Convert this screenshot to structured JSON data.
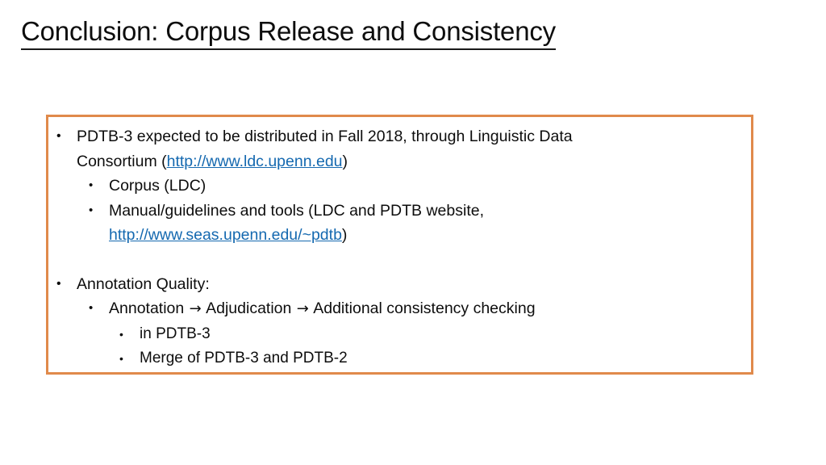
{
  "slide": {
    "title": "Conclusion: Corpus Release and Consistency",
    "bullet_marker": "•",
    "accent_color": "#e08a4b",
    "link_color": "#1569b0",
    "text_color": "#0d0d0d",
    "background_color": "#ffffff"
  },
  "content": {
    "b1_part1": "PDTB-3 expected to be distributed in Fall 2018, through Linguistic Data",
    "b1_part2_pre": "Consortium (",
    "b1_link": "http://www.ldc.upenn.edu",
    "b1_part2_post": ")",
    "b2": "Corpus (LDC)",
    "b3_line1": "Manual/guidelines and tools (LDC and PDTB website,",
    "b3_link": "http://www.seas.upenn.edu/~pdtb",
    "b3_line2_post": ")",
    "b4": "Annotation Quality:",
    "b5_seg1": "Annotation ",
    "b5_arrow1": "→",
    "b5_seg2": " Adjudication ",
    "b5_arrow2": "→",
    "b5_seg3": " Additional consistency checking",
    "b6": "in PDTB-3",
    "b7": "Merge of PDTB-3 and PDTB-2"
  }
}
